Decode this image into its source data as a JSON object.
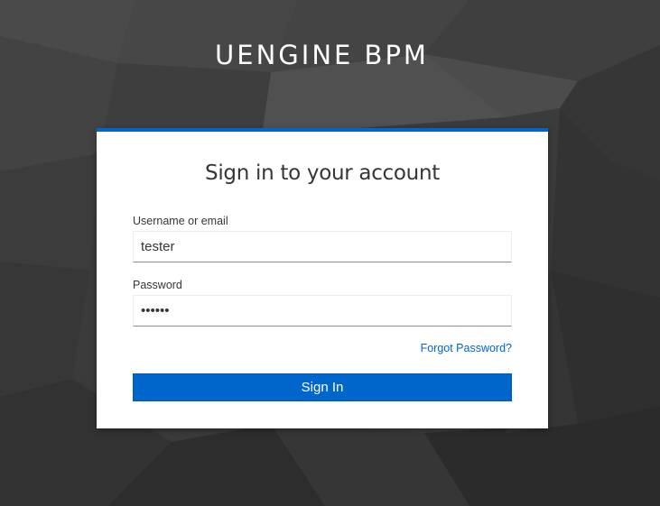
{
  "brand": {
    "title": "UENGINE BPM"
  },
  "login": {
    "heading": "Sign in to your account",
    "username_label": "Username or email",
    "username_value": "tester",
    "password_label": "Password",
    "password_value": "tester",
    "forgot_link": "Forgot Password?",
    "submit_label": "Sign In"
  },
  "colors": {
    "accent": "#0066cc",
    "background": "#3a3a3a",
    "card": "#ffffff",
    "text": "#363636"
  }
}
